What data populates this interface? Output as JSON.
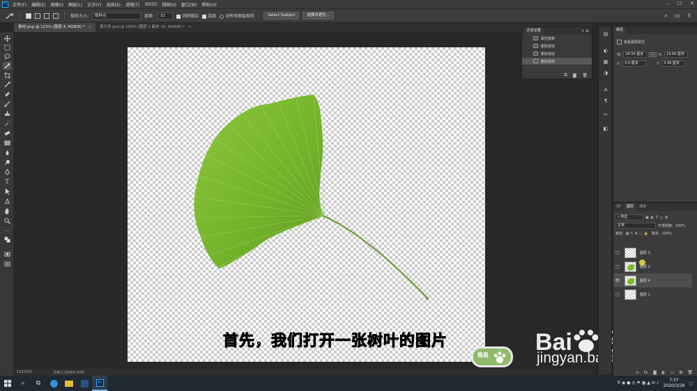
{
  "app": {
    "logo": "Ps"
  },
  "menu": [
    "文件(F)",
    "编辑(E)",
    "图像(I)",
    "图层(L)",
    "文字(Y)",
    "选择(S)",
    "滤镜(T)",
    "3D(D)",
    "视图(V)",
    "窗口(W)",
    "帮助(H)"
  ],
  "options": {
    "sample_size_label": "取样大小:",
    "sample_size_value": "取样点",
    "tolerance_label": "容差:",
    "tolerance_value": "32",
    "antialias_label": "消除锯齿",
    "contiguous_label": "连续",
    "all_layers_label": "对所有图层取样",
    "select_subject": "Select Subject",
    "select_mask": "选择并遮住..."
  },
  "tabs": [
    {
      "label": "素材.png @ 123% (图层 4, RGB/8) *",
      "active": true
    },
    {
      "label": "源文件.psd @ 100% (图层 1 副本 10, RGB/8) *",
      "active": false
    }
  ],
  "subtitle": "首先，我们打开一张树叶的图片",
  "watermark": {
    "brand": "Bai",
    "brand2": "经验",
    "url": "jingyan.baidu.com",
    "badge_text": "简易"
  },
  "status": {
    "zoom": "123.03%",
    "doc": "文档:1.62M/6.47M"
  },
  "history": {
    "title": "历史记录",
    "items": [
      {
        "label": "磁性套索",
        "selected": false
      },
      {
        "label": "删除通道",
        "selected": false
      },
      {
        "label": "删除通道",
        "selected": false
      },
      {
        "label": "删除通道",
        "selected": true
      }
    ]
  },
  "properties": {
    "title": "属性",
    "subtitle": "像素图层属性",
    "w_label": "W:",
    "w_value": "18.94 厘米",
    "h_label": "H:",
    "h_value": "16.69 厘米",
    "x_label": "X:",
    "x_value": "4.9 厘米",
    "y_label": "Y:",
    "y_value": "3.46 厘米",
    "link_label": "GO"
  },
  "layers_panel": {
    "tabs": [
      "3D",
      "图层",
      "通道"
    ],
    "active_tab": "图层",
    "filter": "类型",
    "blend_mode": "正常",
    "opacity_label": "不透明度:",
    "opacity_value": "100%",
    "lock_label": "锁定:",
    "fill_label": "填充:",
    "fill_value": "100%",
    "layers": [
      {
        "name": "图层 3",
        "visible": false,
        "selected": false,
        "has_leaf": false
      },
      {
        "name": "图层 2",
        "visible": false,
        "selected": false,
        "has_leaf": true
      },
      {
        "name": "图层 4",
        "visible": true,
        "selected": true,
        "has_leaf": true
      },
      {
        "name": "图层 1",
        "visible": false,
        "selected": false,
        "has_leaf": false
      }
    ]
  },
  "taskbar": {
    "time": "7:37",
    "date": "2020/3/28"
  },
  "colors": {
    "leaf": "#7dbb2c",
    "accent": "#31a8ff"
  }
}
